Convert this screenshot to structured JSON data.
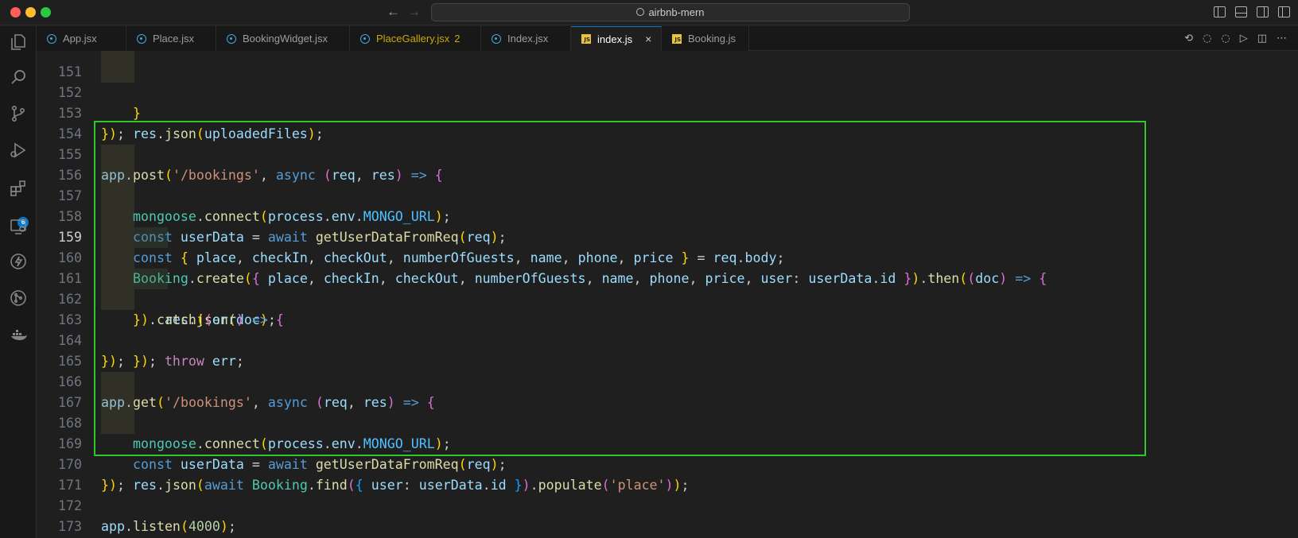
{
  "window": {
    "title": "airbnb-mern"
  },
  "tabs": [
    {
      "label": "App.jsx",
      "icon": "react-icon"
    },
    {
      "label": "Place.jsx",
      "icon": "react-icon"
    },
    {
      "label": "BookingWidget.jsx",
      "icon": "react-icon"
    },
    {
      "label": "PlaceGallery.jsx",
      "icon": "react-icon",
      "problems": "2"
    },
    {
      "label": "Index.jsx",
      "icon": "react-icon"
    },
    {
      "label": "index.js",
      "icon": "js-icon",
      "close": "×"
    },
    {
      "label": "Booking.js",
      "icon": "js-icon"
    }
  ],
  "activity": {
    "extensions_badge": "6"
  },
  "editor": {
    "lines": [
      {
        "n": "151",
        "t": "    }"
      },
      {
        "n": "152",
        "t": "    res.json(uploadedFiles);"
      },
      {
        "n": "153",
        "t": "});"
      },
      {
        "n": "154",
        "t": ""
      },
      {
        "n": "155",
        "t": "app.post('/bookings', async (req, res) => {"
      },
      {
        "n": "156",
        "t": "    mongoose.connect(process.env.MONGO_URL);"
      },
      {
        "n": "157",
        "t": "    const userData = await getUserDataFromReq(req);"
      },
      {
        "n": "158",
        "t": "    const { place, checkIn, checkOut, numberOfGuests, name, phone, price } = req.body;"
      },
      {
        "n": "159",
        "t": "    Booking.create({ place, checkIn, checkOut, numberOfGuests, name, phone, price, user: userData.id }).then((doc) => {"
      },
      {
        "n": "160",
        "t": "        res.json(doc);"
      },
      {
        "n": "161",
        "t": "    }).catch((err) => {"
      },
      {
        "n": "162",
        "t": "        throw err;"
      },
      {
        "n": "163",
        "t": "    });"
      },
      {
        "n": "164",
        "t": "});"
      },
      {
        "n": "165",
        "t": ""
      },
      {
        "n": "166",
        "t": "app.get('/bookings', async (req, res) => {"
      },
      {
        "n": "167",
        "t": "    mongoose.connect(process.env.MONGO_URL);"
      },
      {
        "n": "168",
        "t": "    const userData = await getUserDataFromReq(req);"
      },
      {
        "n": "169",
        "t": "    res.json(await Booking.find({ user: userData.id }).populate('place'));"
      },
      {
        "n": "170",
        "t": "});"
      },
      {
        "n": "171",
        "t": ""
      },
      {
        "n": "172",
        "t": "app.listen(4000);"
      },
      {
        "n": "173",
        "t": ""
      }
    ]
  }
}
